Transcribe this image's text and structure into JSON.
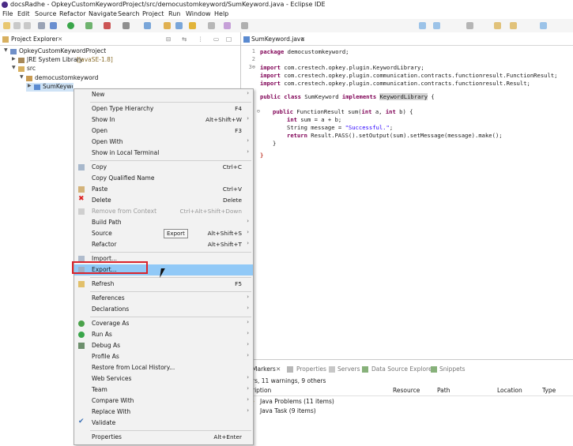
{
  "window": {
    "title": "docsRadhe - OpkeyCustomKeywordProject/src/democustomkeyword/SumKeyword.java - Eclipse IDE"
  },
  "menubar": [
    "File",
    "Edit",
    "Source",
    "Refactor",
    "Navigate",
    "Search",
    "Project",
    "Run",
    "Window",
    "Help"
  ],
  "project_explorer": {
    "tab_label": "Project Explorer",
    "tree": [
      {
        "label": "OpkeyCustomKeywordProject",
        "extra": ""
      },
      {
        "label": "JRE System Library",
        "extra": "[JavaSE-1.8]"
      },
      {
        "label": "src",
        "extra": ""
      },
      {
        "label": "democustomkeyword",
        "extra": ""
      },
      {
        "label": "SumKeyword.java",
        "extra": ""
      }
    ]
  },
  "editor": {
    "tab_label": "SumKeyword.java",
    "line_numbers": [
      "1",
      "2",
      "3⊕"
    ],
    "code": {
      "package_kw": "package",
      "package_name": " democustomkeyword;",
      "imports": [
        "com.crestech.opkey.plugin.KeywordLibrary;",
        "com.crestech.opkey.plugin.communication.contracts.functionresult.FunctionResult;",
        "com.crestech.opkey.plugin.communication.contracts.functionresult.Result;"
      ],
      "import_kw": "import",
      "class_public": "public",
      "class_kw": "class",
      "class_name": "SumKeyword",
      "implements_kw": "implements",
      "interface_name": "KeywordLibrary",
      "open_brace": "{",
      "method_sig_public": "public",
      "method_sig_rest": "FunctionResult sum(",
      "int_kw": "int",
      "method_a": " a, ",
      "method_b": " b) {",
      "line_sum_kw": "int",
      "line_sum_rest": " sum = a + b;",
      "line_msg_type": "String message = ",
      "line_msg_str": "\"Successful.\"",
      "line_msg_end": ";",
      "line_ret_kw": "return",
      "line_ret_rest": " Result.PASS().setOutput(sum).setMessage(message).make();",
      "close_method": "}",
      "close_class": "}"
    }
  },
  "bottom_panel": {
    "tabs": [
      "Markers",
      "Properties",
      "Servers",
      "Data Source Explorer",
      "Snippets"
    ],
    "summary": "rs, 11 warnings, 9 others",
    "columns": [
      "ription",
      "Resource",
      "Path",
      "Location",
      "Type"
    ],
    "rows": [
      "Java Problems (11 items)",
      "Java Task (9 items)"
    ]
  },
  "context_menu": {
    "items": [
      {
        "label": "New",
        "shortcut": "",
        "submenu": true
      },
      {
        "label": "Open Type Hierarchy",
        "shortcut": "F4"
      },
      {
        "label": "Show In",
        "shortcut": "Alt+Shift+W",
        "submenu": true
      },
      {
        "label": "Open",
        "shortcut": "F3"
      },
      {
        "label": "Open With",
        "shortcut": "",
        "submenu": true
      },
      {
        "label": "Show in Local Terminal",
        "shortcut": "",
        "submenu": true
      },
      {
        "label": "Copy",
        "shortcut": "Ctrl+C"
      },
      {
        "label": "Copy Qualified Name",
        "shortcut": ""
      },
      {
        "label": "Paste",
        "shortcut": "Ctrl+V"
      },
      {
        "label": "Delete",
        "shortcut": "Delete"
      },
      {
        "label": "Remove from Context",
        "shortcut": "Ctrl+Alt+Shift+Down"
      },
      {
        "label": "Build Path",
        "shortcut": "",
        "submenu": true
      },
      {
        "label": "Source",
        "shortcut": "Alt+Shift+S",
        "submenu": true
      },
      {
        "label": "Refactor",
        "shortcut": "Alt+Shift+T",
        "submenu": true
      },
      {
        "label": "Import...",
        "shortcut": ""
      },
      {
        "label": "Export...",
        "shortcut": ""
      },
      {
        "label": "Refresh",
        "shortcut": "F5"
      },
      {
        "label": "References",
        "shortcut": "",
        "submenu": true
      },
      {
        "label": "Declarations",
        "shortcut": "",
        "submenu": true
      },
      {
        "label": "Coverage As",
        "shortcut": "",
        "submenu": true
      },
      {
        "label": "Run As",
        "shortcut": "",
        "submenu": true
      },
      {
        "label": "Debug As",
        "shortcut": "",
        "submenu": true
      },
      {
        "label": "Profile As",
        "shortcut": "",
        "submenu": true
      },
      {
        "label": "Restore from Local History...",
        "shortcut": ""
      },
      {
        "label": "Web Services",
        "shortcut": "",
        "submenu": true
      },
      {
        "label": "Team",
        "shortcut": "",
        "submenu": true
      },
      {
        "label": "Compare With",
        "shortcut": "",
        "submenu": true
      },
      {
        "label": "Replace With",
        "shortcut": "",
        "submenu": true
      },
      {
        "label": "Validate",
        "shortcut": ""
      },
      {
        "label": "Properties",
        "shortcut": "Alt+Enter"
      }
    ],
    "tooltip": "Export"
  },
  "colors": {
    "menu_highlight": "#91c9f7",
    "red_annotation": "#d9242c",
    "keyword": "#7f0055",
    "string": "#2a00ff"
  }
}
